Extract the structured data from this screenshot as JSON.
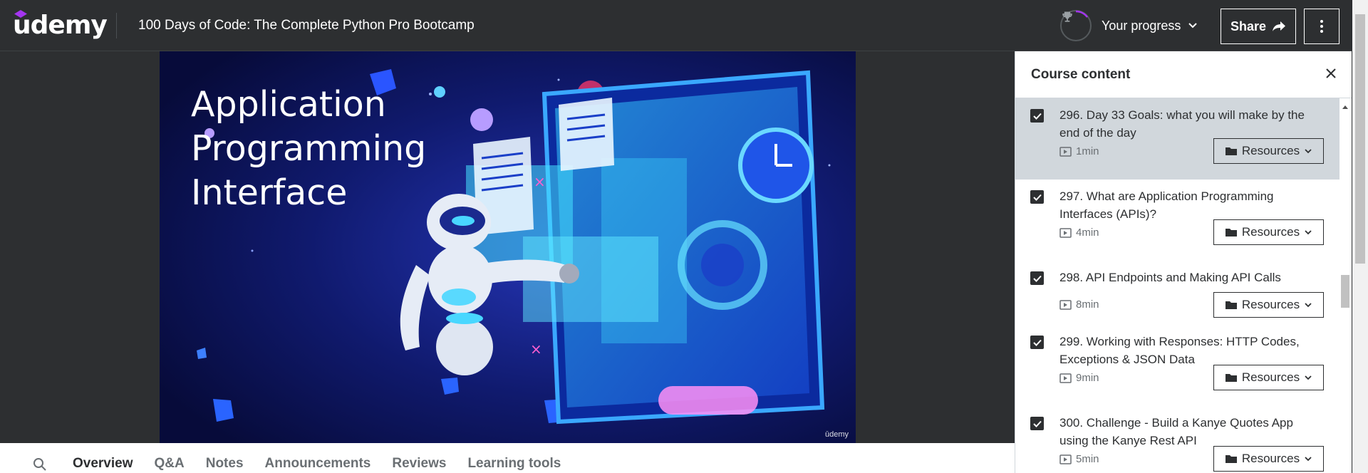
{
  "header": {
    "logo": "udemy",
    "course_title": "100 Days of Code: The Complete Python Pro Bootcamp",
    "progress_label": "Your progress",
    "share_label": "Share"
  },
  "video": {
    "title_lines": [
      "Application",
      "Programming",
      "Interface"
    ],
    "watermark": "ūdemy"
  },
  "tabs": [
    "Overview",
    "Q&A",
    "Notes",
    "Announcements",
    "Reviews",
    "Learning tools"
  ],
  "active_tab": "Overview",
  "sidebar": {
    "title": "Course content",
    "lectures": [
      {
        "title": "296. Day 33 Goals: what you will make by the end of the day",
        "duration": "1min",
        "resources_label": "Resources",
        "completed": true,
        "current": true
      },
      {
        "title": "297. What are Application Programming Interfaces (APIs)?",
        "duration": "4min",
        "resources_label": "Resources",
        "completed": true,
        "current": false
      },
      {
        "title": "298. API Endpoints and Making API Calls",
        "duration": "8min",
        "resources_label": "Resources",
        "completed": true,
        "current": false
      },
      {
        "title": "299. Working with Responses: HTTP Codes, Exceptions & JSON Data",
        "duration": "9min",
        "resources_label": "Resources",
        "completed": true,
        "current": false
      },
      {
        "title": "300. Challenge - Build a Kanye Quotes App using the Kanye Rest API",
        "duration": "5min",
        "resources_label": "Resources",
        "completed": true,
        "current": false
      }
    ]
  },
  "icons": {
    "trophy": "trophy-icon",
    "share": "share-arrow-icon",
    "more": "more-vertical-icon",
    "close": "close-icon",
    "search": "search-icon",
    "video": "play-video-icon",
    "folder": "folder-icon",
    "check": "check-icon",
    "chevron": "chevron-down-icon"
  },
  "colors": {
    "brand_purple": "#a435f0",
    "header_bg": "#2d2f31",
    "current_lecture_bg": "#d1d7dc"
  }
}
